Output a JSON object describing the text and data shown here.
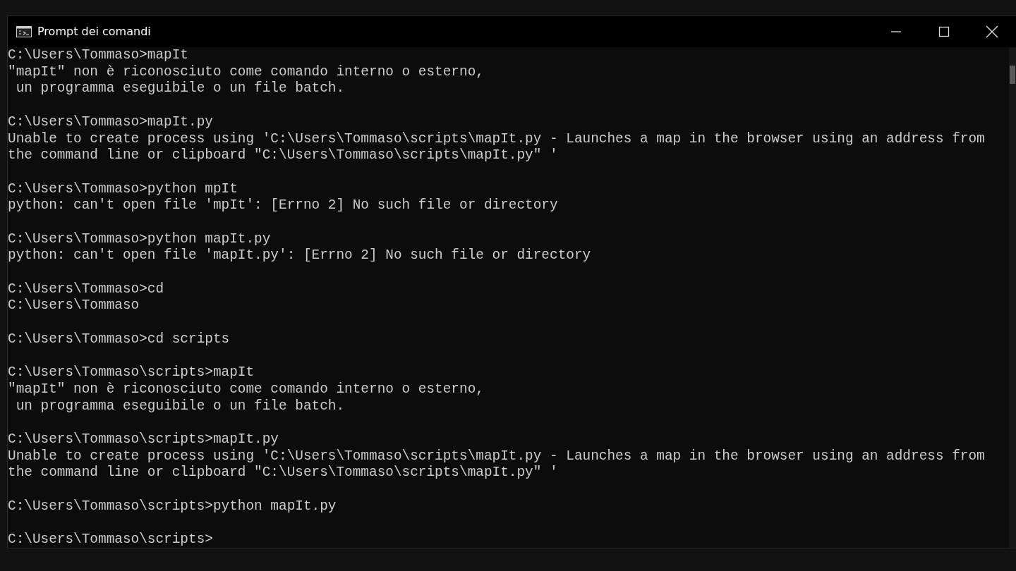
{
  "window": {
    "title": "Prompt dei comandi"
  },
  "console": {
    "blocks": [
      [
        "C:\\Users\\Tommaso>mapIt",
        "\"mapIt\" non è riconosciuto come comando interno o esterno,",
        " un programma eseguibile o un file batch."
      ],
      [
        "C:\\Users\\Tommaso>mapIt.py",
        "Unable to create process using 'C:\\Users\\Tommaso\\scripts\\mapIt.py - Launches a map in the browser using an address from",
        "the command line or clipboard \"C:\\Users\\Tommaso\\scripts\\mapIt.py\" '"
      ],
      [
        "C:\\Users\\Tommaso>python mpIt",
        "python: can't open file 'mpIt': [Errno 2] No such file or directory"
      ],
      [
        "C:\\Users\\Tommaso>python mapIt.py",
        "python: can't open file 'mapIt.py': [Errno 2] No such file or directory"
      ],
      [
        "C:\\Users\\Tommaso>cd",
        "C:\\Users\\Tommaso"
      ],
      [
        "C:\\Users\\Tommaso>cd scripts"
      ],
      [
        "C:\\Users\\Tommaso\\scripts>mapIt",
        "\"mapIt\" non è riconosciuto come comando interno o esterno,",
        " un programma eseguibile o un file batch."
      ],
      [
        "C:\\Users\\Tommaso\\scripts>mapIt.py",
        "Unable to create process using 'C:\\Users\\Tommaso\\scripts\\mapIt.py - Launches a map in the browser using an address from",
        "the command line or clipboard \"C:\\Users\\Tommaso\\scripts\\mapIt.py\" '"
      ],
      [
        "C:\\Users\\Tommaso\\scripts>python mapIt.py"
      ],
      [
        "C:\\Users\\Tommaso\\scripts>"
      ]
    ]
  }
}
